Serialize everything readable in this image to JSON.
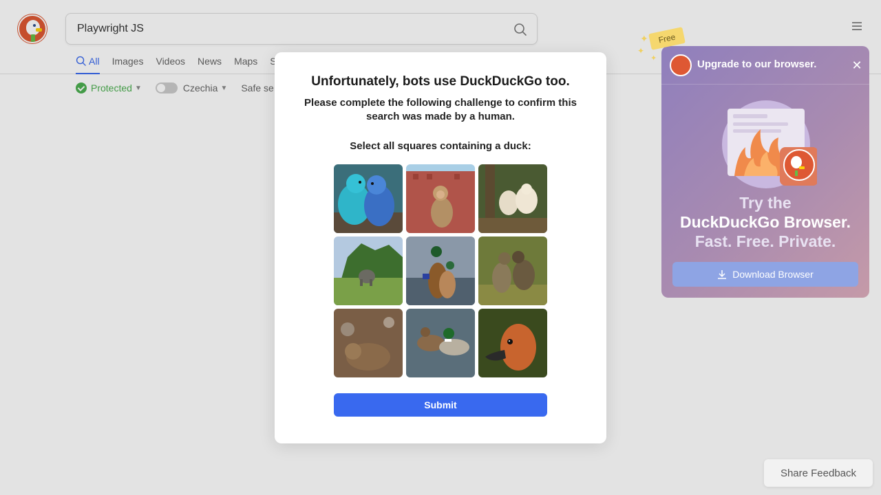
{
  "search": {
    "value": "Playwright JS"
  },
  "tabs": [
    {
      "label": "All",
      "active": true
    },
    {
      "label": "Images"
    },
    {
      "label": "Videos"
    },
    {
      "label": "News"
    },
    {
      "label": "Maps"
    },
    {
      "label": "Sl"
    }
  ],
  "filters": {
    "protected": "Protected",
    "region": "Czechia",
    "safe_search": "Safe se"
  },
  "challenge": {
    "title": "Unfortunately, bots use DuckDuckGo too.",
    "subtitle": "Please complete the following challenge to confirm this search was made by a human.",
    "instruction": "Select all squares containing a duck:",
    "images": [
      {
        "subject": "parakeets"
      },
      {
        "subject": "monkey"
      },
      {
        "subject": "marmots"
      },
      {
        "subject": "elephant"
      },
      {
        "subject": "ducks"
      },
      {
        "subject": "cats"
      },
      {
        "subject": "bear"
      },
      {
        "subject": "ducks"
      },
      {
        "subject": "duck"
      }
    ],
    "submit_label": "Submit"
  },
  "promo": {
    "free_tag": "Free",
    "header": "Upgrade to our browser.",
    "line1": "Try the",
    "line2": "DuckDuckGo Browser.",
    "line3": "Fast. Free. Private.",
    "download_label": "Download Browser"
  },
  "feedback_label": "Share Feedback",
  "colors": {
    "accent": "#3969ef",
    "brand": "#de5833",
    "protected": "#4caf50"
  }
}
